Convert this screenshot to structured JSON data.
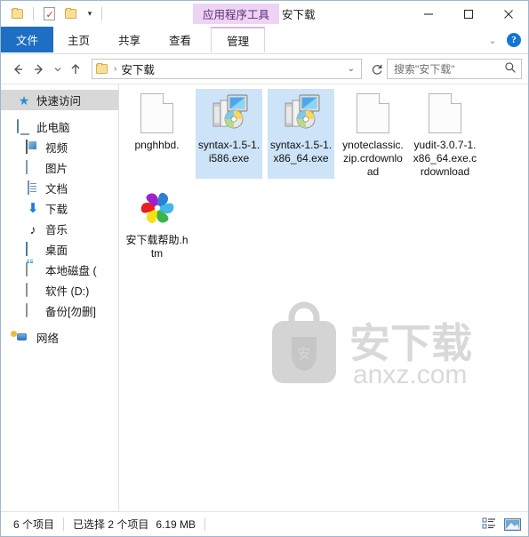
{
  "window": {
    "title": "安下载",
    "contextual_tab_header": "应用程序工具",
    "controls": {
      "minimize": "minimize-button",
      "maximize": "maximize-button",
      "close": "close-button"
    }
  },
  "quick_access_toolbar": {
    "items": [
      {
        "name": "folder-icon",
        "label": ""
      },
      {
        "name": "properties-icon",
        "label": ""
      },
      {
        "name": "new-folder-icon",
        "label": ""
      },
      {
        "name": "customize-dropdown",
        "label": "▾"
      }
    ]
  },
  "ribbon": {
    "tabs": [
      {
        "id": "file",
        "label": "文件",
        "active": true
      },
      {
        "id": "home",
        "label": "主页",
        "active": false
      },
      {
        "id": "share",
        "label": "共享",
        "active": false
      },
      {
        "id": "view",
        "label": "查看",
        "active": false
      },
      {
        "id": "manage",
        "label": "管理",
        "active": false,
        "contextual": true
      }
    ],
    "collapse_label": "⌄",
    "help_label": "?"
  },
  "addressbar": {
    "back": "back-arrow",
    "forward": "forward-arrow",
    "recent": "recent-locations-dropdown",
    "up": "up-arrow",
    "breadcrumb": [
      "安下载"
    ],
    "dropdown": "⌄",
    "refresh": "refresh-icon"
  },
  "search": {
    "placeholder": "搜索\"安下载\"",
    "icon": "search-icon"
  },
  "sidebar": {
    "items": [
      {
        "label": "快速访问",
        "icon": "star-icon",
        "selected": true,
        "level": 0
      },
      {
        "label": "此电脑",
        "icon": "computer-icon",
        "selected": false,
        "level": 0
      },
      {
        "label": "视频",
        "icon": "video-icon",
        "selected": false,
        "level": 1
      },
      {
        "label": "图片",
        "icon": "pictures-icon",
        "selected": false,
        "level": 1
      },
      {
        "label": "文档",
        "icon": "documents-icon",
        "selected": false,
        "level": 1
      },
      {
        "label": "下载",
        "icon": "downloads-icon",
        "selected": false,
        "level": 1
      },
      {
        "label": "音乐",
        "icon": "music-icon",
        "selected": false,
        "level": 1
      },
      {
        "label": "桌面",
        "icon": "desktop-icon",
        "selected": false,
        "level": 1
      },
      {
        "label": "本地磁盘 (",
        "icon": "system-drive-icon",
        "selected": false,
        "level": 1
      },
      {
        "label": "软件 (D:)",
        "icon": "drive-icon",
        "selected": false,
        "level": 1
      },
      {
        "label": "备份[勿删]",
        "icon": "drive-icon",
        "selected": false,
        "level": 1
      },
      {
        "label": "网络",
        "icon": "network-icon",
        "selected": false,
        "level": 0
      }
    ]
  },
  "files": [
    {
      "name": "pnghhbd.",
      "icon": "generic-file-icon",
      "selected": false
    },
    {
      "name": "syntax-1.5-1.i586.exe",
      "icon": "installer-exe-icon",
      "selected": true
    },
    {
      "name": "syntax-1.5-1.x86_64.exe",
      "icon": "installer-exe-icon",
      "selected": true
    },
    {
      "name": "ynoteclassic.zip.crdownload",
      "icon": "generic-file-icon",
      "selected": false
    },
    {
      "name": "yudit-3.0.7-1.x86_64.exe.crdownload",
      "icon": "generic-file-icon",
      "selected": false
    },
    {
      "name": "安下载帮助.htm",
      "icon": "pinwheel-html-icon",
      "selected": false
    }
  ],
  "watermark": {
    "text": "安",
    "brand": "安下载",
    "domain": "anxz.com"
  },
  "statusbar": {
    "item_count": "6 个项目",
    "selection": "已选择 2 个项目",
    "size": "6.19 MB",
    "view_buttons": [
      {
        "name": "details-view-button"
      },
      {
        "name": "large-icons-view-button",
        "active": true
      }
    ]
  },
  "colors": {
    "file_tab": "#1e6fc4",
    "contextual_tab": "#eed3f4",
    "selection": "#cde3f7",
    "nav_selection": "#d8d8d8"
  }
}
